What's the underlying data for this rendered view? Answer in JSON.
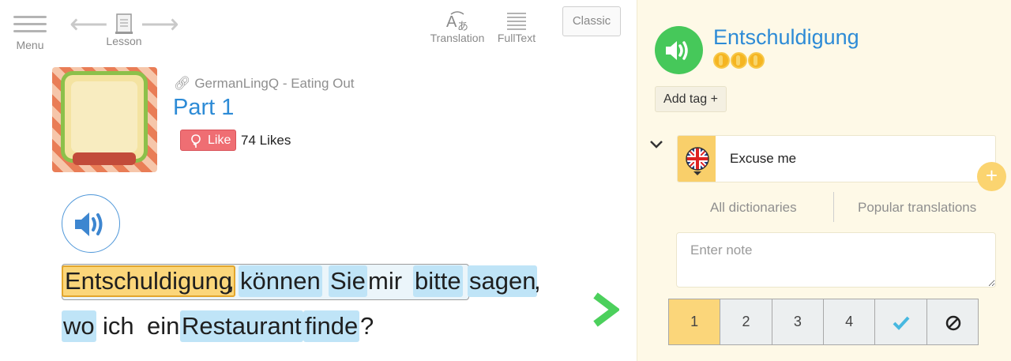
{
  "toolbar": {
    "menu_label": "Menu",
    "lesson_label": "Lesson",
    "translation_label": "Translation",
    "fulltext_label": "FullText",
    "classic_label": "Classic"
  },
  "lesson": {
    "course": "GermanLingQ - Eating Out",
    "title": "Part 1",
    "like_label": "Like",
    "likes_count": "74 Likes"
  },
  "text": {
    "line1": [
      {
        "t": "Entschuldigung",
        "s": "sel"
      },
      {
        "t": ",",
        "s": ""
      },
      {
        "t": "können",
        "s": "blue"
      },
      {
        "t": "Sie",
        "s": "blue"
      },
      {
        "t": "mir",
        "s": ""
      },
      {
        "t": "bitte",
        "s": "blue"
      },
      {
        "t": "sagen",
        "s": "blue"
      },
      {
        "t": ",",
        "s": ""
      }
    ],
    "line2": [
      {
        "t": "wo",
        "s": "blue"
      },
      {
        "t": "ich",
        "s": ""
      },
      {
        "t": "ein",
        "s": ""
      },
      {
        "t": "Restaurant",
        "s": "blue"
      },
      {
        "t": "finde",
        "s": "blue"
      },
      {
        "t": "?",
        "s": ""
      }
    ]
  },
  "panel": {
    "term": "Entschuldigung",
    "coins": 3,
    "add_tag": "Add tag +",
    "hint": "Excuse me",
    "plus": "+",
    "tab_all": "All dictionaries",
    "tab_popular": "Popular translations",
    "note_placeholder": "Enter note",
    "status": [
      "1",
      "2",
      "3",
      "4"
    ],
    "active_status": "1"
  },
  "colors": {
    "accent_blue": "#2d8bd6",
    "highlight_blue": "#bfe4f7",
    "selected_yellow": "#fbd67a",
    "like_red": "#ef6e73",
    "audio_green": "#46c85a",
    "panel_bg": "#fef9e7"
  },
  "icons": [
    "menu-icon",
    "back-arrow-icon",
    "lesson-icon",
    "forward-arrow-icon",
    "translation-icon",
    "fulltext-icon",
    "link-icon",
    "rose-icon",
    "speaker-icon",
    "next-chevron-icon",
    "expand-chevron-icon",
    "uk-flag-icon",
    "check-icon",
    "ignore-icon"
  ]
}
